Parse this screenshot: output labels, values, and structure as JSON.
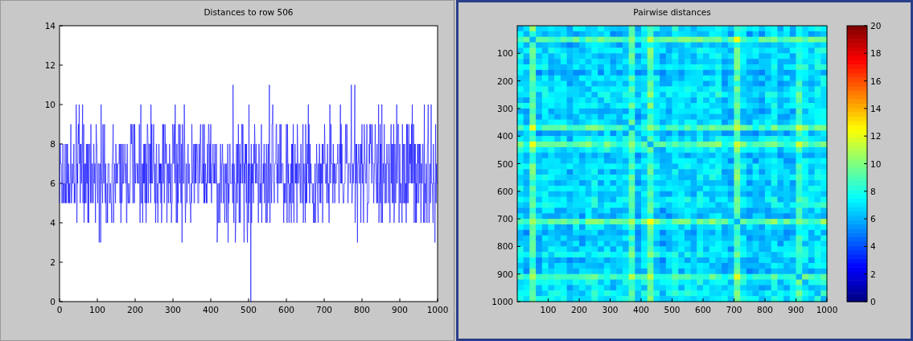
{
  "windows": [
    {
      "kind": "line_plot",
      "active": false,
      "title": "Distances to row 506",
      "y_ticks": [
        "14",
        "12",
        "10",
        "8",
        "6",
        "4",
        "2",
        "0"
      ],
      "x_ticks": [
        "0",
        "100",
        "200",
        "300",
        "400",
        "500",
        "600",
        "700",
        "800",
        "900",
        "1000"
      ]
    },
    {
      "kind": "heatmap",
      "active": true,
      "title": "Pairwise distances",
      "y_ticks": [
        "100",
        "200",
        "300",
        "400",
        "500",
        "600",
        "700",
        "800",
        "900",
        "1000"
      ],
      "x_ticks": [
        "100",
        "200",
        "300",
        "400",
        "500",
        "600",
        "700",
        "800",
        "900",
        "1000"
      ],
      "colorbar_ticks": [
        "20",
        "18",
        "16",
        "14",
        "12",
        "10",
        "8",
        "6",
        "4",
        "2",
        "0"
      ]
    }
  ]
}
